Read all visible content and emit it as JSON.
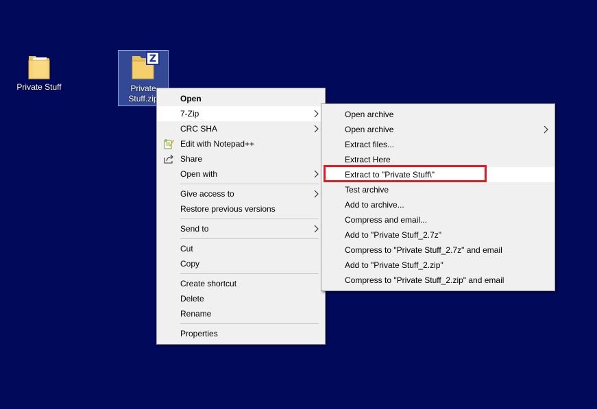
{
  "desktop": {
    "folder_label": "Private Stuff",
    "zip_label_line1": "Private",
    "zip_label_line2": "Stuff.zip"
  },
  "context_menu": {
    "items": [
      {
        "label": "Open",
        "bold": true
      },
      {
        "label": "7-Zip",
        "submenu": true,
        "hover": true
      },
      {
        "label": "CRC SHA",
        "submenu": true
      },
      {
        "label": "Edit with Notepad++",
        "icon": "notepadpp-icon"
      },
      {
        "label": "Share",
        "icon": "share-icon"
      },
      {
        "label": "Open with",
        "submenu": true
      },
      {
        "label": "Give access to",
        "submenu": true
      },
      {
        "label": "Restore previous versions"
      },
      {
        "label": "Send to",
        "submenu": true
      },
      {
        "label": "Cut"
      },
      {
        "label": "Copy"
      },
      {
        "label": "Create shortcut"
      },
      {
        "label": "Delete"
      },
      {
        "label": "Rename"
      },
      {
        "label": "Properties"
      }
    ]
  },
  "sevenzip_submenu": {
    "items": [
      {
        "label": "Open archive"
      },
      {
        "label": "Open archive",
        "submenu": true
      },
      {
        "label": "Extract files..."
      },
      {
        "label": "Extract Here"
      },
      {
        "label": "Extract to \"Private Stuff\\\"",
        "hover": true,
        "highlighted": true
      },
      {
        "label": "Test archive"
      },
      {
        "label": "Add to archive..."
      },
      {
        "label": "Compress and email..."
      },
      {
        "label": "Add to \"Private Stuff_2.7z\""
      },
      {
        "label": "Compress to \"Private Stuff_2.7z\" and email"
      },
      {
        "label": "Add to \"Private Stuff_2.zip\""
      },
      {
        "label": "Compress to \"Private Stuff_2.zip\" and email"
      }
    ]
  },
  "colors": {
    "desktop_bg": "#00095a",
    "menu_bg": "#f0f0f0",
    "highlight_border": "#e21b23"
  }
}
